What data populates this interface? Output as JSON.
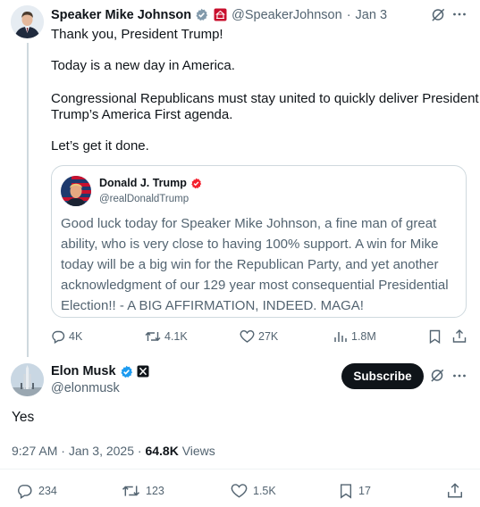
{
  "tweet": {
    "author_name": "Speaker Mike Johnson",
    "handle": "@SpeakerJohnson",
    "date_sep": "·",
    "date": "Jan 3",
    "lines": [
      "Thank you, President Trump!",
      "Today is a new day in America.",
      "Congressional Republicans must stay united to quickly deliver President",
      "Trump’s America First agenda.",
      "Let’s get it done."
    ],
    "quote": {
      "author_name": "Donald J. Trump",
      "handle": "@realDonaldTrump",
      "lines": [
        "Good luck today for Speaker Mike Johnson, a fine man of great",
        "ability, who is very close to having 100% support. A win for Mike",
        "today will be a big win for the Republican Party, and yet another",
        "acknowledgment of our 129 year most consequential Presidential",
        "Election!! - A BIG AFFIRMATION, INDEED. MAGA!"
      ]
    },
    "actions": {
      "replies": "4K",
      "reposts": "4.1K",
      "likes": "27K",
      "views": "1.8M"
    }
  },
  "reply": {
    "author_name": "Elon Musk",
    "handle": "@elonmusk",
    "subscribe_label": "Subscribe",
    "text": "Yes",
    "time": "9:27 AM",
    "date": "Jan 3, 2025",
    "sep": "·",
    "views_count": "64.8K",
    "views_label": "Views",
    "actions": {
      "replies": "234",
      "reposts": "123",
      "likes": "1.5K",
      "bookmarks": "17"
    }
  },
  "icons": {
    "verified": "verified-badge-icon",
    "grok": "grok-icon",
    "more": "more-icon",
    "reply": "reply-icon",
    "repost": "repost-icon",
    "like": "like-icon",
    "views": "views-icon",
    "bookmark": "bookmark-icon",
    "share": "share-icon"
  },
  "colors": {
    "verified_blue": "#1d9bf0",
    "verified_gray": "#829aab",
    "trump_badge": "#f4212e",
    "text": "#0f1419",
    "muted": "#536471"
  }
}
